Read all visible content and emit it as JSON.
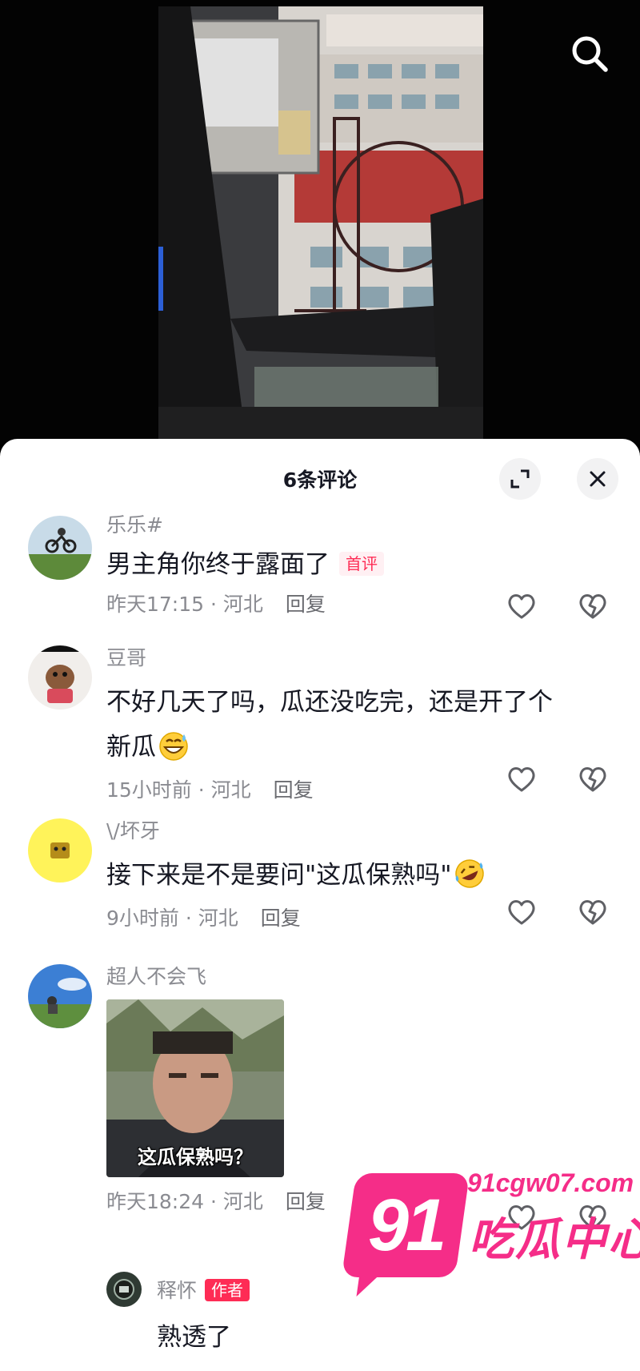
{
  "video": {
    "search_icon": "search-icon"
  },
  "sheet": {
    "title": "6条评论",
    "expand_icon": "expand-icon",
    "close_icon": "close-icon"
  },
  "comments": [
    {
      "user": "乐乐#",
      "text": "男主角你终于露面了",
      "badge": "首评",
      "time_location": "昨天17:15 · 河北",
      "reply_label": "回复"
    },
    {
      "user": "豆哥",
      "text_line1": "不好几天了吗，瓜还没吃完，还是开了个",
      "text_line2": "新瓜",
      "emoji": "grinning-sweat-emoji",
      "time_location": "15小时前 · 河北",
      "reply_label": "回复"
    },
    {
      "user": "\\/坏牙",
      "text": "接下来是不是要问\"这瓜保熟吗\"",
      "emoji": "rolling-laughing-emoji",
      "time_location": "9小时前 · 河北",
      "reply_label": "回复"
    },
    {
      "user": "超人不会飞",
      "image_caption": "这瓜保熟吗？",
      "time_location": "昨天18:24 · 河北",
      "reply_label": "回复",
      "reply": {
        "user": "释怀",
        "badge": "作者",
        "text": "熟透了"
      }
    }
  ],
  "watermark": {
    "number": "91",
    "url": "91cgw07.com",
    "brand": "吃瓜中心"
  },
  "colors": {
    "accent": "#fe2c55",
    "watermark": "#f52d88",
    "secondary_text": "#8a8b91"
  }
}
